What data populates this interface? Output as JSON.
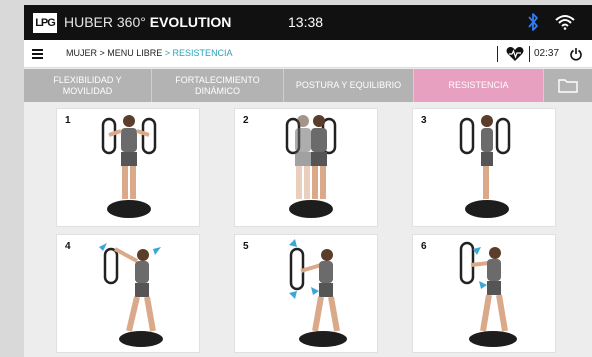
{
  "header": {
    "logo_text": "LPG",
    "brand_light": "HUBER 360°",
    "brand_bold": "EVOLUTION",
    "time": "13:38"
  },
  "breadcrumb": {
    "path": "MUJER > MENU LIBRE",
    "current": "> RESISTENCIA",
    "timer": "02:37"
  },
  "tabs": [
    {
      "label_line1": "FLEXIBILIDAD Y",
      "label_line2": "MOVILIDAD",
      "active": false
    },
    {
      "label_line1": "FORTALECIMIENTO",
      "label_line2": "DINÁMICO",
      "active": false
    },
    {
      "label_line1": "POSTURA Y EQUILIBRIO",
      "label_line2": "",
      "active": false
    },
    {
      "label_line1": "RESISTENCIA",
      "label_line2": "",
      "active": true
    }
  ],
  "exercises": [
    {
      "number": "1"
    },
    {
      "number": "2"
    },
    {
      "number": "3"
    },
    {
      "number": "4"
    },
    {
      "number": "5"
    },
    {
      "number": "6"
    }
  ],
  "colors": {
    "active_tab": "#e7a0bf",
    "inactive_tab": "#b3b3b3",
    "breadcrumb_active": "#2aa3b8",
    "bluetooth": "#2f7cf6",
    "arrow_accent": "#3aa7d8"
  },
  "icons": [
    "bluetooth-icon",
    "wifi-icon",
    "menu-icon",
    "heart-rate-icon",
    "power-icon",
    "folder-icon"
  ]
}
